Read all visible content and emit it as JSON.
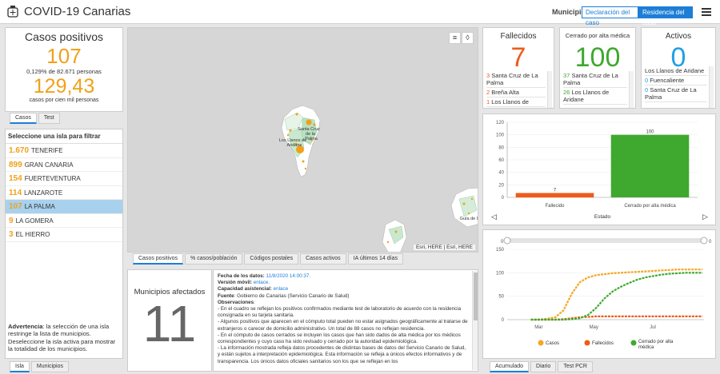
{
  "header": {
    "title": "COVID-19 Canarias",
    "municipio_label": "Municipio",
    "seg_declaracion": "Declaración del caso",
    "seg_residencia": "Residencia del caso"
  },
  "positivos": {
    "title": "Casos positivos",
    "value": "107",
    "pct_text": "0,129% de 82.671 personas",
    "rate": "129,43",
    "rate_text": "casos por cien mil personas",
    "tabs": [
      "Casos",
      "Test"
    ]
  },
  "islands": {
    "header": "Seleccione una isla para filtrar",
    "items": [
      {
        "count": "1.670",
        "name": "TENERIFE",
        "selected": false
      },
      {
        "count": "899",
        "name": "GRAN CANARIA",
        "selected": false
      },
      {
        "count": "154",
        "name": "FUERTEVENTURA",
        "selected": false
      },
      {
        "count": "114",
        "name": "LANZAROTE",
        "selected": false
      },
      {
        "count": "107",
        "name": "LA PALMA",
        "selected": true
      },
      {
        "count": "9",
        "name": "LA GOMERA",
        "selected": false
      },
      {
        "count": "3",
        "name": "EL HIERRO",
        "selected": false
      }
    ],
    "advert_bold": "Advertencia",
    "advert_text": ": la selección de una isla restringe la lista de municipios. Deseleccione la isla activa para mostrar la totalidad de los municipios.",
    "tabs": [
      "Isla",
      "Municipios"
    ]
  },
  "map": {
    "labels": {
      "santa_cruz": "Santa Cruz de la Palma",
      "llanos": "Los Llanos de Aridane",
      "gomera": "Guía de I"
    },
    "attribution": "Esri, HERE | Esri, HERE",
    "tabs": [
      "Casos positivos",
      "% casos/población",
      "Códigos postales",
      "Casos activos",
      "IA últimos 14 días"
    ]
  },
  "municipios": {
    "title": "Municipios afectados",
    "value": "11"
  },
  "notes": {
    "fecha_label": "Fecha de los datos:",
    "fecha": "11/8/2020 14:00:37.",
    "movil_label": "Versión móvil:",
    "movil_link": "enlace.",
    "capacidad_label": "Capacidad asistencial:",
    "capacidad_link": "enlace",
    "fuente_label": "Fuente",
    "fuente": ": Gobierno de Canarias (Servicio Canario de Salud)",
    "obs_label": "Observaciones",
    "paragraphs": [
      "- En el cuadro se reflejan los positivos confirmados mediante test de laboratorio de acuerdo con la residencia consignada en su tarjeta sanitaria.",
      "- Algunos positivos que aparecen en el cómputo total pueden no estar asignados geográficamente al tratarse de extranjeros o carecer de domicilio administrativo. Un total de 88 casos no reflejan residencia.",
      "- En el cómputo de casos cerrados se incluyen los casos que han sido dados de alta médica por los médicos correspondientes y cuyo caso ha sido revisado y cerrado por la autoridad epidemiológica.",
      "- La información mostrada refleja datos procedentes de distintas bases de datos del Servicio Canario de Salud, y están sujetos a interpretación epidemiológica. Esta información se refleja a únicos efectos informativos y de transparencia. Los únicos datos oficiales sanitarios son los que se reflejan en los"
    ]
  },
  "fallecidos": {
    "title": "Fallecidos",
    "value": "7",
    "color": "#f05a1a",
    "items": [
      {
        "n": "3",
        "name": "Santa Cruz de La Palma"
      },
      {
        "n": "2",
        "name": "Breña Alta"
      },
      {
        "n": "1",
        "name": "Los Llanos de"
      }
    ]
  },
  "cerrado": {
    "title": "Cerrado por alta médica",
    "value": "100",
    "color": "#3ea92e",
    "items": [
      {
        "n": "37",
        "name": "Santa Cruz de La Palma"
      },
      {
        "n": "26",
        "name": "Los Llanos de Aridane"
      }
    ]
  },
  "activos": {
    "title": "Activos",
    "value": "0",
    "color": "#1ea0e6",
    "items": [
      {
        "n": "",
        "name": "Los Llanos de Aridane"
      },
      {
        "n": "0",
        "name": "Fuencaliente"
      },
      {
        "n": "0",
        "name": "Santa Cruz de La Palma"
      }
    ]
  },
  "bar_chart": {
    "chart_data": {
      "type": "bar",
      "categories": [
        "Fallecido",
        "Cerrado por alta médica"
      ],
      "values": [
        7,
        100
      ],
      "colors": [
        "#f05a1a",
        "#3ea92e"
      ],
      "xlabel": "Estado",
      "ylim": [
        0,
        120
      ],
      "yticks": [
        0,
        20,
        40,
        60,
        80,
        100,
        120
      ]
    }
  },
  "line_chart": {
    "chart_data": {
      "type": "line",
      "x_ticks": [
        "Mar",
        "May",
        "Jul"
      ],
      "ylim": [
        0,
        150
      ],
      "yticks": [
        0,
        50,
        100,
        150
      ],
      "slider_labels": [
        "0",
        "0"
      ],
      "series": [
        {
          "name": "Casos",
          "color": "#f5a623",
          "values": [
            0,
            0,
            2,
            5,
            20,
            55,
            80,
            90,
            95,
            97,
            99,
            100,
            101,
            102,
            103,
            104,
            105,
            106,
            107,
            107,
            107,
            107
          ]
        },
        {
          "name": "Fallecidos",
          "color": "#f05a1a",
          "values": [
            0,
            0,
            0,
            0,
            1,
            3,
            5,
            6,
            7,
            7,
            7,
            7,
            7,
            7,
            7,
            7,
            7,
            7,
            7,
            7,
            7,
            7
          ]
        },
        {
          "name": "Cerrado por alta médica",
          "color": "#3ea92e",
          "values": [
            0,
            0,
            0,
            0,
            0,
            1,
            3,
            10,
            25,
            45,
            60,
            70,
            78,
            85,
            90,
            93,
            96,
            98,
            99,
            100,
            100,
            100
          ]
        }
      ]
    },
    "tabs": [
      "Acumulado",
      "Diario",
      "Test PCR"
    ]
  }
}
